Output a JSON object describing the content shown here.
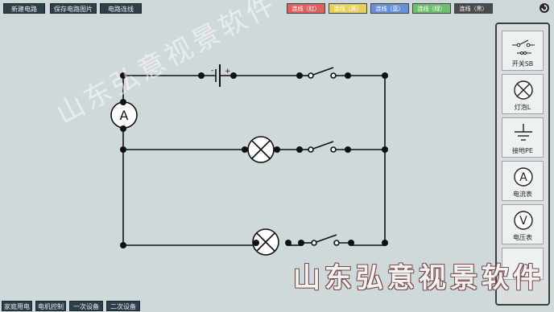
{
  "toolbar": {
    "new_circuit": "新建电路",
    "save_image": "保存电路图片",
    "wiring": "电路连线"
  },
  "wire_colors": [
    {
      "label": "连线（红）",
      "color": "#e06060",
      "text": "#ffffff"
    },
    {
      "label": "连线（黄）",
      "color": "#e8d060",
      "text": "#ffffff"
    },
    {
      "label": "连线（蓝）",
      "color": "#6a8fd8",
      "text": "#ffffff"
    },
    {
      "label": "连线（绿）",
      "color": "#6cc06c",
      "text": "#ffffff"
    },
    {
      "label": "连线（黑）",
      "color": "#4a4a4a",
      "text": "#ffffff"
    }
  ],
  "components": [
    {
      "label": "开关SB",
      "icon": "switch-icon"
    },
    {
      "label": "灯泡L",
      "icon": "lamp-icon"
    },
    {
      "label": "接地PE",
      "icon": "ground-icon"
    },
    {
      "label": "电流表",
      "icon": "ammeter-icon",
      "symbol": "A"
    },
    {
      "label": "电压表",
      "icon": "voltmeter-icon",
      "symbol": "V"
    }
  ],
  "bottom_tabs": {
    "home": "家庭用电",
    "motor": "电机控制",
    "primary": "一次设备",
    "secondary": "二次设备"
  },
  "canvas": {
    "ammeter_symbol": "A"
  },
  "watermark": {
    "text": "山东弘意视景软件"
  }
}
